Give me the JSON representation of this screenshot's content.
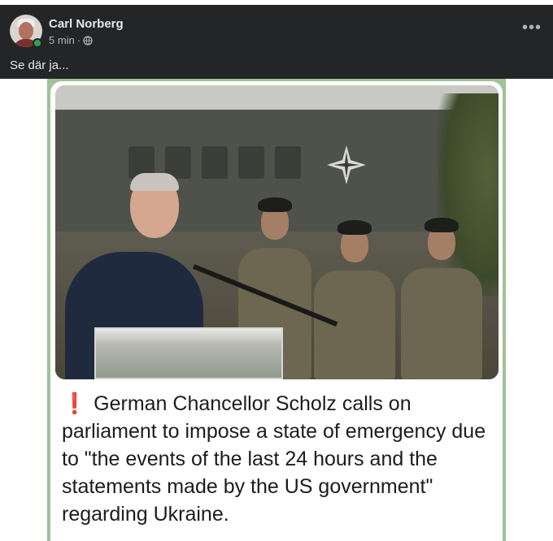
{
  "post": {
    "author": "Carl Norberg",
    "time": "5 min",
    "separator": "·",
    "privacy_icon": "globe-icon",
    "more_label": "•••",
    "text": "Se där ja..."
  },
  "image": {
    "caption_icon": "❗",
    "caption": "German Chancellor Scholz calls on parliament to impose a state of emergency due to \"the events of the last 24 hours and the statements made by the US government\" regarding Ukraine."
  },
  "colors": {
    "header_bg": "#242526",
    "online": "#31a24c",
    "frame_green": "#9fc296",
    "alert_red": "#e02020"
  }
}
